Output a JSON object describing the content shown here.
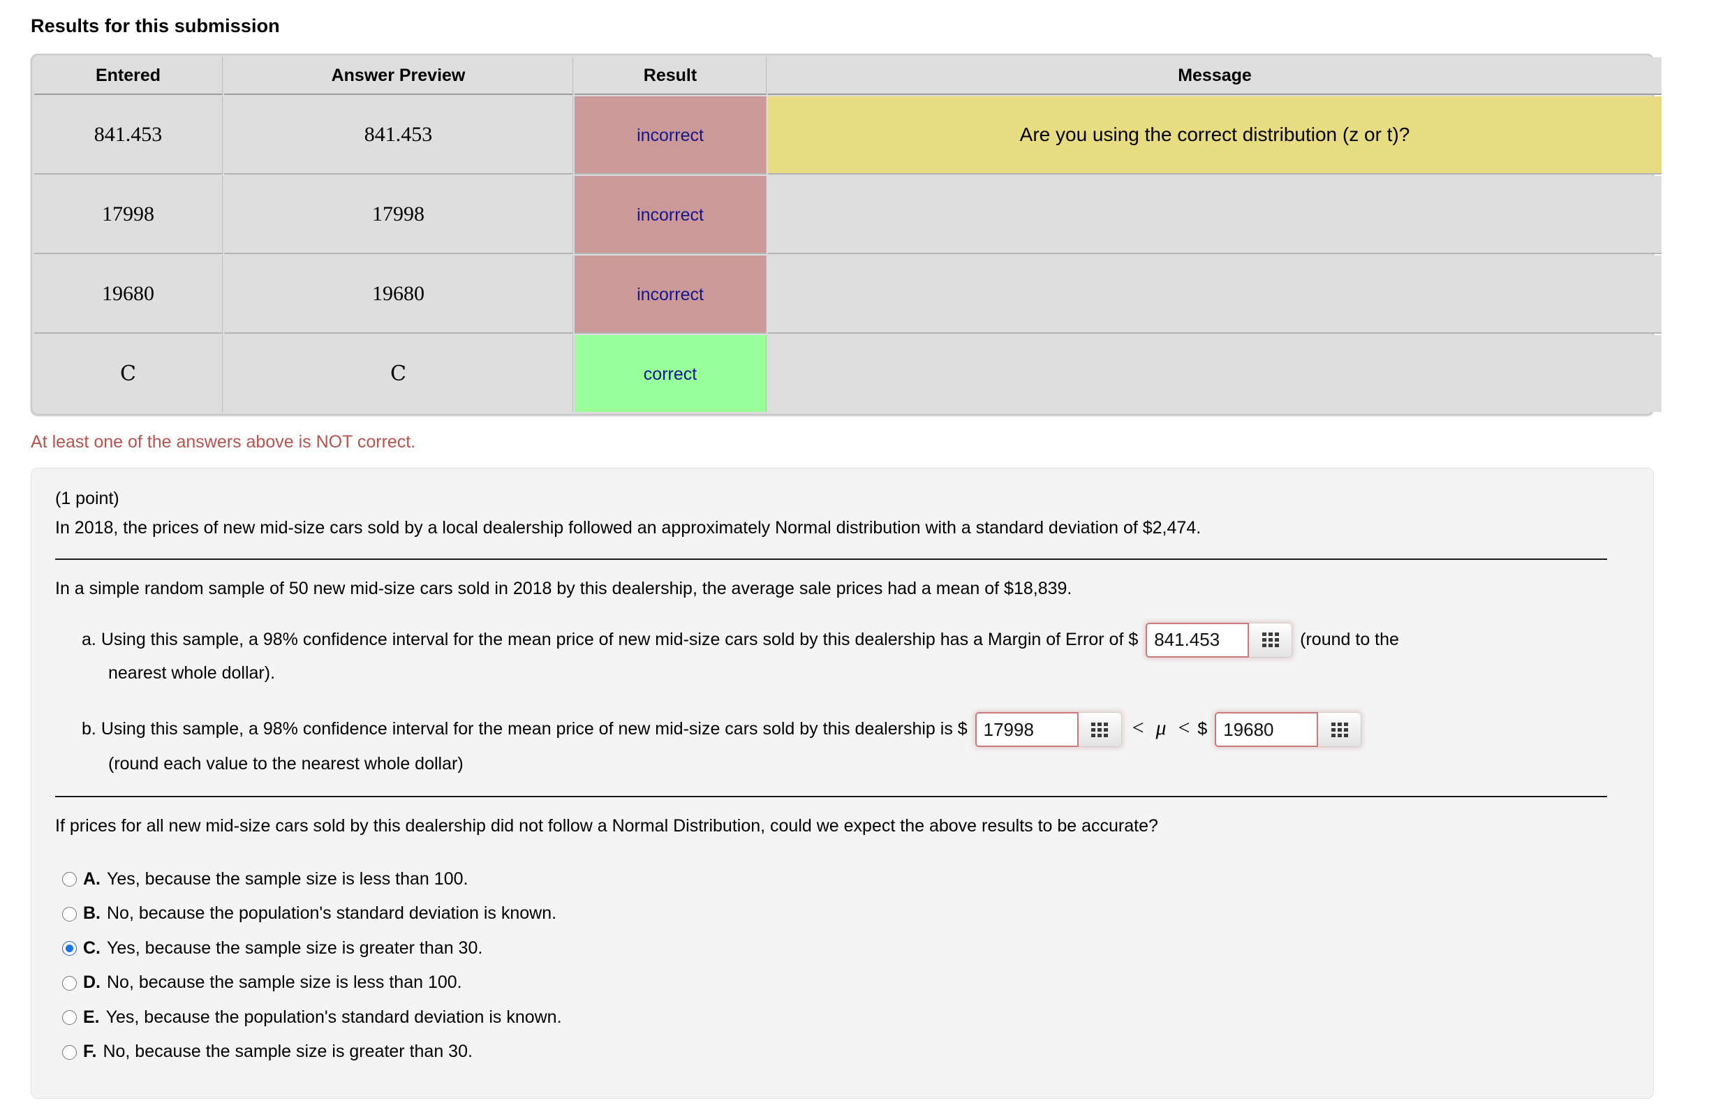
{
  "heading": "Results for this submission",
  "results_table": {
    "columns": [
      "Entered",
      "Answer Preview",
      "Result",
      "Message"
    ],
    "rows": [
      {
        "entered": "841.453",
        "preview": "841.453",
        "result": "incorrect",
        "message": "Are you using the correct distribution (z or t)?",
        "result_state": "incorrect",
        "message_state": "warn"
      },
      {
        "entered": "17998",
        "preview": "17998",
        "result": "incorrect",
        "message": "",
        "result_state": "incorrect",
        "message_state": "empty"
      },
      {
        "entered": "19680",
        "preview": "19680",
        "result": "incorrect",
        "message": "",
        "result_state": "incorrect",
        "message_state": "empty"
      },
      {
        "entered": "C",
        "preview": "C",
        "result": "correct",
        "message": "",
        "result_state": "correct",
        "message_state": "empty"
      }
    ]
  },
  "notice": "At least one of the answers above is NOT correct.",
  "problem": {
    "points": "(1 point)",
    "intro": "In 2018, the prices of new mid-size cars sold by a local dealership followed an approximately Normal distribution with a standard deviation of $2,474.",
    "sample_statement": "In a simple random sample of 50 new mid-size cars sold in 2018 by this dealership, the average sale prices had a mean of $18,839.",
    "part_a": {
      "label": "a.",
      "text_before": "Using this sample, a 98% confidence interval for the mean price of new mid-size cars sold by this dealership has a Margin of Error of $",
      "text_after": "(round to the",
      "second_line": "nearest whole dollar).",
      "input_value": "841.453",
      "input_placeholder": ""
    },
    "part_b": {
      "label": "b.",
      "text_before": "Using this sample, a 98% confidence interval for the mean price of new mid-size cars sold by this dealership is $",
      "lower_value": "17998",
      "upper_value": "19680",
      "middle_lt_1": "<",
      "mu_symbol": "μ",
      "middle_lt_2": "<",
      "dollar": "$",
      "second_line": "(round each value to the nearest whole dollar)"
    },
    "question": "If prices for all new mid-size cars sold by this dealership did not follow a Normal Distribution, could we expect the above results to be accurate?",
    "options": [
      {
        "letter": "A.",
        "text": "Yes, because the sample size is less than 100.",
        "selected": false
      },
      {
        "letter": "B.",
        "text": "No, because the population's standard deviation is known.",
        "selected": false
      },
      {
        "letter": "C.",
        "text": "Yes, because the sample size is greater than 30.",
        "selected": true
      },
      {
        "letter": "D.",
        "text": "No, because the sample size is less than 100.",
        "selected": false
      },
      {
        "letter": "E.",
        "text": "Yes, because the population's standard deviation is known.",
        "selected": false
      },
      {
        "letter": "F.",
        "text": "No, because the sample size is greater than 30.",
        "selected": false
      }
    ]
  },
  "icons": {
    "keypad": "grid-3x3-icon"
  },
  "colors": {
    "incorrect_bg": "#cc9999",
    "correct_bg": "#99ff99",
    "message_warn_bg": "#e8dc82",
    "result_text": "#16168c",
    "notice_text": "#b5534f",
    "panel_bg": "#f4f4f4",
    "radio_accent": "#1a73e8",
    "input_border": "#c97b7b"
  }
}
